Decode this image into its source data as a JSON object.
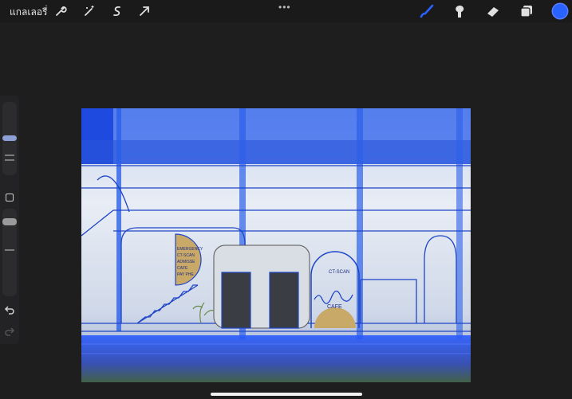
{
  "topbar": {
    "gallery_label": "แกลเลอรี่",
    "tools_left": [
      "wrench-icon",
      "magic-wand-icon",
      "selection-s-icon",
      "arrow-cursor-icon"
    ],
    "tools_right": [
      "brush-icon",
      "smudge-icon",
      "eraser-icon",
      "layers-icon"
    ],
    "more_label": "•••",
    "current_color": "#2a62ff"
  },
  "sidebar": {
    "brush_size_level": 0.25,
    "opacity_level": 0.5
  },
  "canvas": {
    "sign_left": [
      "EMERGENCY",
      "CT-SCAN",
      "ADMISSE",
      "CAFE",
      "PAY PHE"
    ],
    "sign_ct": "CT-SCAN",
    "sign_cafe": "CAFE"
  }
}
